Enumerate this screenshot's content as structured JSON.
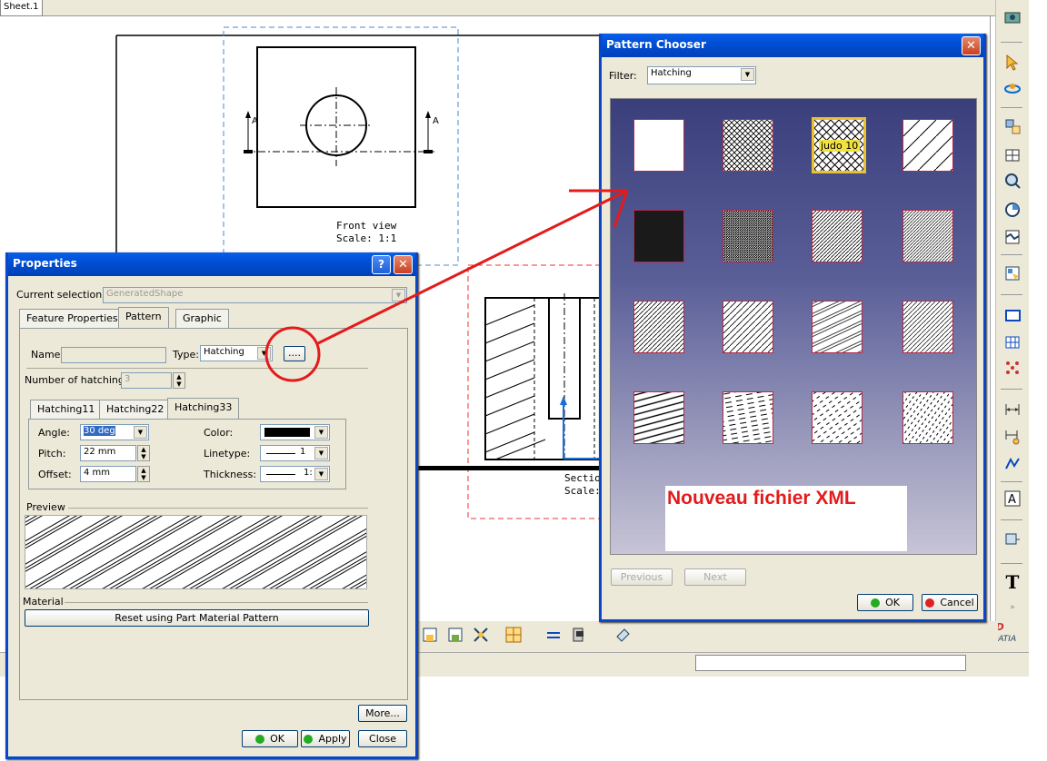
{
  "sheet_tab": "Sheet.1",
  "drawing": {
    "front_view_title": "Front view",
    "front_view_scale": "Scale:  1:1",
    "section_label_left": "A",
    "section_label_right": "A",
    "section_view_title": "Sectio",
    "section_view_scale": "Scale:"
  },
  "properties": {
    "title": "Properties",
    "help_label": "?",
    "close_label": "✕",
    "current_selection_label": "Current selection :",
    "current_selection_value": "GeneratedShape",
    "tabs": [
      "Feature Properties",
      "Pattern",
      "Graphic"
    ],
    "active_tab": "Pattern",
    "name_label": "Name:",
    "name_value": "",
    "type_label": "Type:",
    "type_value": "Hatching",
    "browse_label": "....",
    "num_hatchings_label": "Number of hatchings:",
    "num_hatchings_value": "3",
    "hatching_tabs": [
      "Hatching11",
      "Hatching22",
      "Hatching33"
    ],
    "active_hatching_tab": "Hatching33",
    "angle_label": "Angle:",
    "angle_value": "30 deg",
    "pitch_label": "Pitch:",
    "pitch_value": "22 mm",
    "offset_label": "Offset:",
    "offset_value": "4 mm",
    "color_label": "Color:",
    "color_value": "#000000",
    "linetype_label": "Linetype:",
    "linetype_value": "1",
    "thickness_label": "Thickness:",
    "thickness_value": "1:",
    "preview_label": "Preview",
    "material_label": "Material",
    "reset_button": "Reset using Part Material Pattern",
    "more_button": "More...",
    "ok_button": "OK",
    "apply_button": "Apply",
    "close_button": "Close"
  },
  "pattern_chooser": {
    "title": "Pattern Chooser",
    "close_label": "✕",
    "filter_label": "Filter:",
    "filter_value": "Hatching",
    "selected_tile_label": "judo 10",
    "tiles": [
      "blank",
      "crosshatch-fine",
      "crosshatch-selected",
      "diagonal-wide",
      "solid-black",
      "dense-dark",
      "diagonal-medium-dense",
      "diagonal-dense",
      "diagonal-medium",
      "diagonal-sparse",
      "diagonal-double",
      "diagonal-fine",
      "diagonal-bold",
      "dashed-horizontal",
      "dashed-diagonal",
      "dotted-diagonal"
    ],
    "annotation": "Nouveau fichier XML",
    "previous_button": "Previous",
    "next_button": "Next",
    "ok_button": "OK",
    "cancel_button": "Cancel"
  },
  "brand": "CATIA",
  "colors": {
    "title_bar": "#0050d6",
    "annotation_red": "#e31b1b",
    "tile_border": "#b02a4a",
    "chooser_bg_top": "#3a3f7c",
    "chooser_bg_bottom": "#c7c4d6"
  }
}
